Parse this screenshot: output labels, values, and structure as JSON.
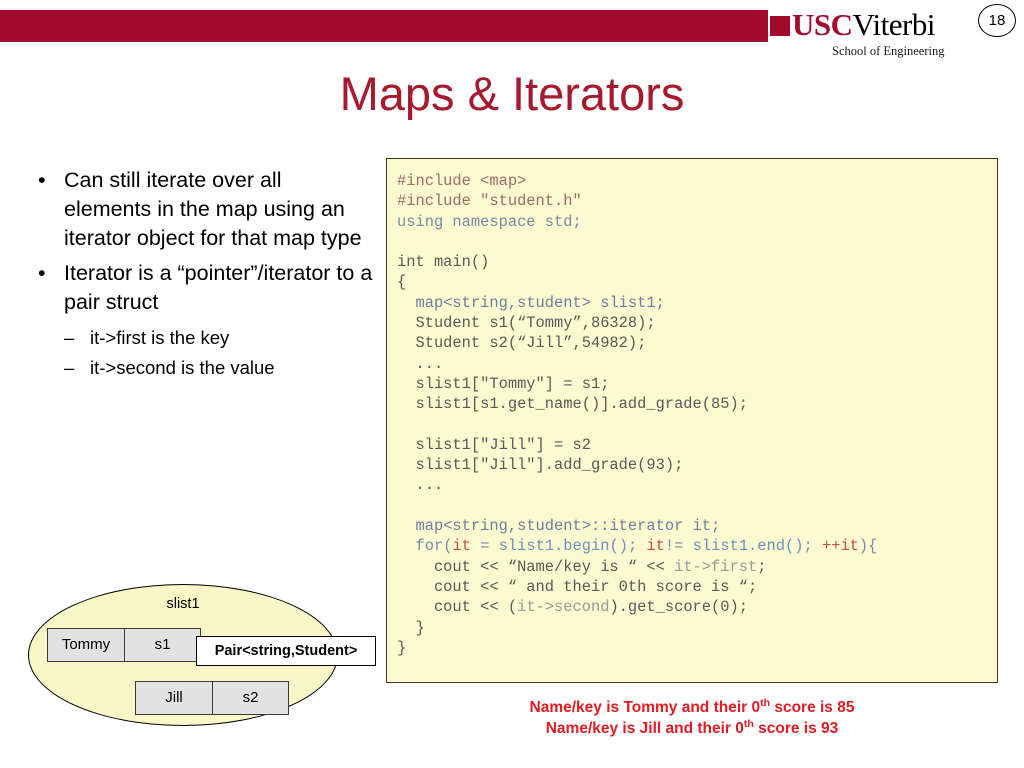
{
  "header": {
    "bar_color": "#A20B2E",
    "logo_usc": "USC",
    "logo_viterbi": "Viterbi",
    "tagline": "School of Engineering",
    "page_number": "18"
  },
  "title": "Maps & Iterators",
  "bullets": [
    {
      "level": 1,
      "marker": "•",
      "text": "Can still iterate over all elements in the map using an iterator object for that map type"
    },
    {
      "level": 1,
      "marker": "•",
      "text": "Iterator is a “pointer”/iterator to a pair struct"
    },
    {
      "level": 2,
      "marker": "–",
      "text": "it->first is the key"
    },
    {
      "level": 2,
      "marker": "–",
      "text": "it->second is the value"
    }
  ],
  "diagram": {
    "ellipse_label": "slist1",
    "callout_label": "Pair<string,Student>",
    "rows": [
      {
        "key": "Tommy",
        "value": "s1"
      },
      {
        "key": "Jill",
        "value": "s2"
      }
    ]
  },
  "code": {
    "lines": [
      [
        {
          "t": "#include <map>",
          "c": "c-pre"
        }
      ],
      [
        {
          "t": "#include \"student.h\"",
          "c": "c-pre"
        }
      ],
      [
        {
          "t": "using namespace std;",
          "c": "c-kw"
        }
      ],
      [
        {
          "t": "",
          "c": "c-plain"
        }
      ],
      [
        {
          "t": "int main()",
          "c": "c-plain"
        }
      ],
      [
        {
          "t": "{",
          "c": "c-plain"
        }
      ],
      [
        {
          "t": "  ",
          "c": "c-plain"
        },
        {
          "t": "map<string,student> slist1;",
          "c": "c-type"
        }
      ],
      [
        {
          "t": "  Student s1(“Tommy”,86328);",
          "c": "c-plain"
        }
      ],
      [
        {
          "t": "  Student s2(“Jill”,54982);",
          "c": "c-plain"
        }
      ],
      [
        {
          "t": "  ...",
          "c": "c-plain"
        }
      ],
      [
        {
          "t": "  slist1[\"Tommy\"] = s1;",
          "c": "c-plain"
        }
      ],
      [
        {
          "t": "  slist1[s1.get_name()].add_grade(85);",
          "c": "c-plain"
        }
      ],
      [
        {
          "t": "",
          "c": "c-plain"
        }
      ],
      [
        {
          "t": "  slist1[\"Jill\"] = s2",
          "c": "c-plain"
        }
      ],
      [
        {
          "t": "  slist1[\"Jill\"].add_grade(93);",
          "c": "c-plain"
        }
      ],
      [
        {
          "t": "  ...",
          "c": "c-plain"
        }
      ],
      [
        {
          "t": "",
          "c": "c-plain"
        }
      ],
      [
        {
          "t": "  ",
          "c": "c-plain"
        },
        {
          "t": "map<string,student>::iterator it;",
          "c": "c-type"
        }
      ],
      [
        {
          "t": "  ",
          "c": "c-plain"
        },
        {
          "t": "for(",
          "c": "c-kw"
        },
        {
          "t": "it",
          "c": "c-var"
        },
        {
          "t": " = ",
          "c": "c-kw"
        },
        {
          "t": "slist1.begin()",
          "c": "c-call"
        },
        {
          "t": "; ",
          "c": "c-kw"
        },
        {
          "t": "it",
          "c": "c-var"
        },
        {
          "t": "!= ",
          "c": "c-kw"
        },
        {
          "t": "slist1.end()",
          "c": "c-call"
        },
        {
          "t": "; ",
          "c": "c-kw"
        },
        {
          "t": "++it",
          "c": "c-var"
        },
        {
          "t": "){",
          "c": "c-kw"
        }
      ],
      [
        {
          "t": "    cout << “Name/key is “ << ",
          "c": "c-plain"
        },
        {
          "t": "it->first",
          "c": "c-mem"
        },
        {
          "t": ";",
          "c": "c-plain"
        }
      ],
      [
        {
          "t": "    cout << “ and their 0th score is “;",
          "c": "c-plain"
        }
      ],
      [
        {
          "t": "    cout << (",
          "c": "c-plain"
        },
        {
          "t": "it->second",
          "c": "c-mem"
        },
        {
          "t": ").get_score(0);",
          "c": "c-plain"
        }
      ],
      [
        {
          "t": "  }",
          "c": "c-plain"
        }
      ],
      [
        {
          "t": "}",
          "c": "c-plain"
        }
      ]
    ]
  },
  "console_output": {
    "line1_pre": "Name/key is Tommy and their 0",
    "line1_sup": "th",
    "line1_post": " score is 85",
    "line2_pre": "Name/key is Jill and their 0",
    "line2_sup": "th",
    "line2_post": " score is 93",
    "color": "#E01B24"
  }
}
